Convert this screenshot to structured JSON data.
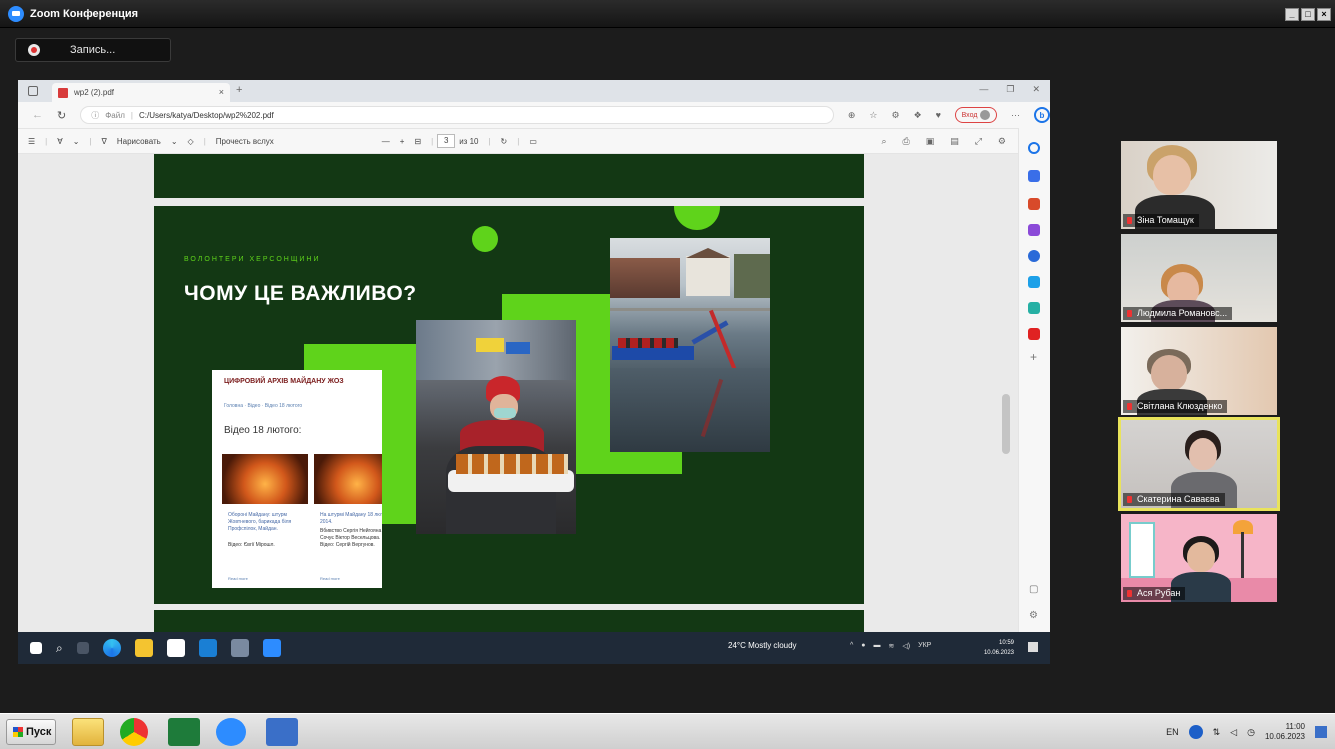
{
  "zoom": {
    "window_title": "Zoom Конференция",
    "recording_label": "Запись..."
  },
  "browser": {
    "tab_title": "wp2 (2).pdf",
    "new_tab": "+",
    "url_prefix": "Файл",
    "url": "C:/Users/katya/Desktop/wp2%202.pdf",
    "profile_label": "Вход",
    "pdf_toolbar": {
      "draw_label": "Нарисовать",
      "read_aloud_label": "Прочесть вслух",
      "page_current": "3",
      "page_total": "из 10"
    }
  },
  "slide": {
    "kicker": "ВОЛОНТЕРИ ХЕРСОНЩИНИ",
    "title": "ЧОМУ ЦЕ ВАЖЛИВО?",
    "archive_card": {
      "title": "ЦИФРОВИЙ АРХІВ МАЙДАНУ ЖОЗ",
      "breadcrumbs": "Головна · Відео · Відео 18 лютого",
      "heading": "Відео 18 лютого:",
      "item1_text": "Обороні Майдану: штурм Жовтневого, барикада біля Профспілок, Майдан.",
      "item1_author": "Відео: Євгії Мірошл.",
      "item2_text": "На штурмі Майдану 18 лютого 2014.",
      "item2_author": "Вбивство Сергія Нейгояна Сочує Віктор Весельцова. Відео: Сергій Вергунов.",
      "read_more": "Read more"
    }
  },
  "inner_taskbar": {
    "weather": "24°C  Mostly cloudy",
    "lang": "УКР",
    "time": "10:59",
    "date": "10.06.2023"
  },
  "participants": [
    {
      "name": "Зіна Томащук"
    },
    {
      "name": "Людмила Романовс..."
    },
    {
      "name": "Світлана Клюзденко"
    },
    {
      "name": "Скатерина Саваєва"
    },
    {
      "name": "Ася Рубан"
    }
  ],
  "os_taskbar": {
    "start_label": "Пуск",
    "lang": "EN",
    "time": "11:00",
    "date": "10.06.2023"
  }
}
